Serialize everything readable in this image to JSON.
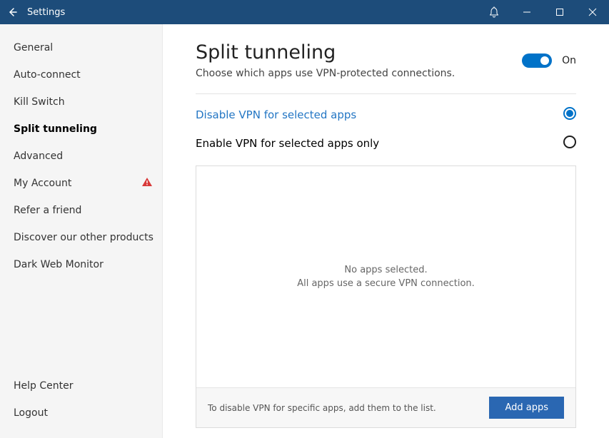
{
  "titlebar": {
    "title": "Settings"
  },
  "sidebar": {
    "items": [
      {
        "label": "General"
      },
      {
        "label": "Auto-connect"
      },
      {
        "label": "Kill Switch"
      },
      {
        "label": "Split tunneling"
      },
      {
        "label": "Advanced"
      },
      {
        "label": "My Account"
      },
      {
        "label": "Refer a friend"
      },
      {
        "label": "Discover our other products"
      },
      {
        "label": "Dark Web Monitor"
      }
    ],
    "lower": [
      {
        "label": "Help Center"
      },
      {
        "label": "Logout"
      }
    ]
  },
  "main": {
    "title": "Split tunneling",
    "subtitle": "Choose which apps use VPN-protected connections.",
    "toggle": {
      "state_label": "On"
    },
    "options": {
      "disable": "Disable VPN for selected apps",
      "enable": "Enable VPN for selected apps only"
    },
    "empty": {
      "line1": "No apps selected.",
      "line2": "All apps use a secure VPN connection."
    },
    "footer": {
      "hint": "To disable VPN for specific apps, add them to the list.",
      "add": "Add apps"
    }
  }
}
